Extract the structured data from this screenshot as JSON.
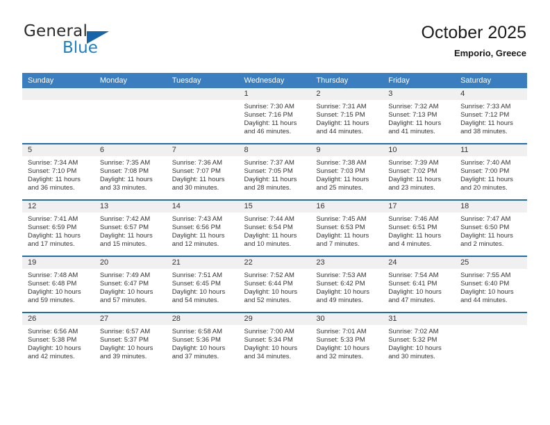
{
  "brand": {
    "word_one": "General",
    "word_two": "Blue",
    "triangle_icon": "triangle-icon"
  },
  "header": {
    "title": "October 2025",
    "location": "Emporio, Greece"
  },
  "calendar": {
    "weekday_headers": [
      "Sunday",
      "Monday",
      "Tuesday",
      "Wednesday",
      "Thursday",
      "Friday",
      "Saturday"
    ],
    "accent_color": "#3b7ebf",
    "row_border_color": "#1f6bb0",
    "daynum_band_color": "#f0f0f0",
    "weeks": [
      [
        {
          "day": "",
          "lines": []
        },
        {
          "day": "",
          "lines": []
        },
        {
          "day": "",
          "lines": []
        },
        {
          "day": "1",
          "lines": [
            "Sunrise: 7:30 AM",
            "Sunset: 7:16 PM",
            "Daylight: 11 hours",
            "and 46 minutes."
          ]
        },
        {
          "day": "2",
          "lines": [
            "Sunrise: 7:31 AM",
            "Sunset: 7:15 PM",
            "Daylight: 11 hours",
            "and 44 minutes."
          ]
        },
        {
          "day": "3",
          "lines": [
            "Sunrise: 7:32 AM",
            "Sunset: 7:13 PM",
            "Daylight: 11 hours",
            "and 41 minutes."
          ]
        },
        {
          "day": "4",
          "lines": [
            "Sunrise: 7:33 AM",
            "Sunset: 7:12 PM",
            "Daylight: 11 hours",
            "and 38 minutes."
          ]
        }
      ],
      [
        {
          "day": "5",
          "lines": [
            "Sunrise: 7:34 AM",
            "Sunset: 7:10 PM",
            "Daylight: 11 hours",
            "and 36 minutes."
          ]
        },
        {
          "day": "6",
          "lines": [
            "Sunrise: 7:35 AM",
            "Sunset: 7:08 PM",
            "Daylight: 11 hours",
            "and 33 minutes."
          ]
        },
        {
          "day": "7",
          "lines": [
            "Sunrise: 7:36 AM",
            "Sunset: 7:07 PM",
            "Daylight: 11 hours",
            "and 30 minutes."
          ]
        },
        {
          "day": "8",
          "lines": [
            "Sunrise: 7:37 AM",
            "Sunset: 7:05 PM",
            "Daylight: 11 hours",
            "and 28 minutes."
          ]
        },
        {
          "day": "9",
          "lines": [
            "Sunrise: 7:38 AM",
            "Sunset: 7:03 PM",
            "Daylight: 11 hours",
            "and 25 minutes."
          ]
        },
        {
          "day": "10",
          "lines": [
            "Sunrise: 7:39 AM",
            "Sunset: 7:02 PM",
            "Daylight: 11 hours",
            "and 23 minutes."
          ]
        },
        {
          "day": "11",
          "lines": [
            "Sunrise: 7:40 AM",
            "Sunset: 7:00 PM",
            "Daylight: 11 hours",
            "and 20 minutes."
          ]
        }
      ],
      [
        {
          "day": "12",
          "lines": [
            "Sunrise: 7:41 AM",
            "Sunset: 6:59 PM",
            "Daylight: 11 hours",
            "and 17 minutes."
          ]
        },
        {
          "day": "13",
          "lines": [
            "Sunrise: 7:42 AM",
            "Sunset: 6:57 PM",
            "Daylight: 11 hours",
            "and 15 minutes."
          ]
        },
        {
          "day": "14",
          "lines": [
            "Sunrise: 7:43 AM",
            "Sunset: 6:56 PM",
            "Daylight: 11 hours",
            "and 12 minutes."
          ]
        },
        {
          "day": "15",
          "lines": [
            "Sunrise: 7:44 AM",
            "Sunset: 6:54 PM",
            "Daylight: 11 hours",
            "and 10 minutes."
          ]
        },
        {
          "day": "16",
          "lines": [
            "Sunrise: 7:45 AM",
            "Sunset: 6:53 PM",
            "Daylight: 11 hours",
            "and 7 minutes."
          ]
        },
        {
          "day": "17",
          "lines": [
            "Sunrise: 7:46 AM",
            "Sunset: 6:51 PM",
            "Daylight: 11 hours",
            "and 4 minutes."
          ]
        },
        {
          "day": "18",
          "lines": [
            "Sunrise: 7:47 AM",
            "Sunset: 6:50 PM",
            "Daylight: 11 hours",
            "and 2 minutes."
          ]
        }
      ],
      [
        {
          "day": "19",
          "lines": [
            "Sunrise: 7:48 AM",
            "Sunset: 6:48 PM",
            "Daylight: 10 hours",
            "and 59 minutes."
          ]
        },
        {
          "day": "20",
          "lines": [
            "Sunrise: 7:49 AM",
            "Sunset: 6:47 PM",
            "Daylight: 10 hours",
            "and 57 minutes."
          ]
        },
        {
          "day": "21",
          "lines": [
            "Sunrise: 7:51 AM",
            "Sunset: 6:45 PM",
            "Daylight: 10 hours",
            "and 54 minutes."
          ]
        },
        {
          "day": "22",
          "lines": [
            "Sunrise: 7:52 AM",
            "Sunset: 6:44 PM",
            "Daylight: 10 hours",
            "and 52 minutes."
          ]
        },
        {
          "day": "23",
          "lines": [
            "Sunrise: 7:53 AM",
            "Sunset: 6:42 PM",
            "Daylight: 10 hours",
            "and 49 minutes."
          ]
        },
        {
          "day": "24",
          "lines": [
            "Sunrise: 7:54 AM",
            "Sunset: 6:41 PM",
            "Daylight: 10 hours",
            "and 47 minutes."
          ]
        },
        {
          "day": "25",
          "lines": [
            "Sunrise: 7:55 AM",
            "Sunset: 6:40 PM",
            "Daylight: 10 hours",
            "and 44 minutes."
          ]
        }
      ],
      [
        {
          "day": "26",
          "lines": [
            "Sunrise: 6:56 AM",
            "Sunset: 5:38 PM",
            "Daylight: 10 hours",
            "and 42 minutes."
          ]
        },
        {
          "day": "27",
          "lines": [
            "Sunrise: 6:57 AM",
            "Sunset: 5:37 PM",
            "Daylight: 10 hours",
            "and 39 minutes."
          ]
        },
        {
          "day": "28",
          "lines": [
            "Sunrise: 6:58 AM",
            "Sunset: 5:36 PM",
            "Daylight: 10 hours",
            "and 37 minutes."
          ]
        },
        {
          "day": "29",
          "lines": [
            "Sunrise: 7:00 AM",
            "Sunset: 5:34 PM",
            "Daylight: 10 hours",
            "and 34 minutes."
          ]
        },
        {
          "day": "30",
          "lines": [
            "Sunrise: 7:01 AM",
            "Sunset: 5:33 PM",
            "Daylight: 10 hours",
            "and 32 minutes."
          ]
        },
        {
          "day": "31",
          "lines": [
            "Sunrise: 7:02 AM",
            "Sunset: 5:32 PM",
            "Daylight: 10 hours",
            "and 30 minutes."
          ]
        },
        {
          "day": "",
          "lines": []
        }
      ]
    ]
  }
}
